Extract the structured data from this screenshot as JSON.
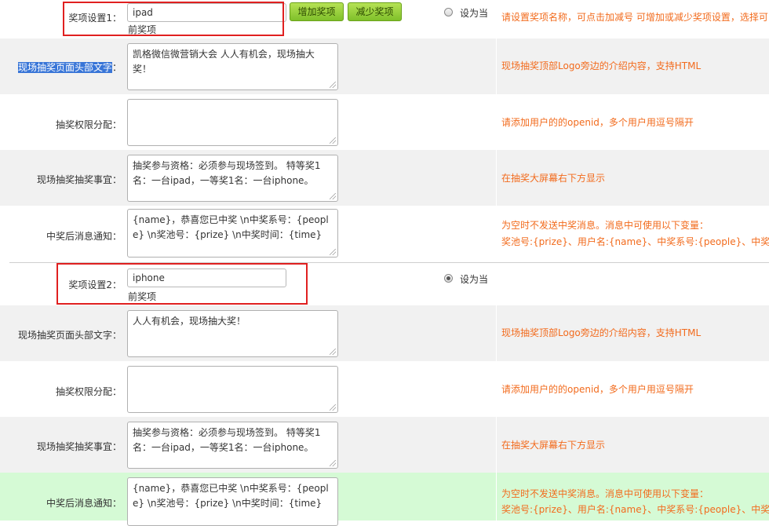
{
  "prizes": [
    {
      "setting_label": "奖项设置1：",
      "name_value": "ipad",
      "sub_label": "前奖项",
      "add_button": "增加奖项",
      "remove_button": "减少奖项",
      "radio_label": "设为当",
      "radio_checked": false,
      "setting_hint": "请设置奖项名称，可点击加减号 可增加或减少奖项设置，选择可",
      "header_text_label": "现场抽奖页面头部文字：",
      "header_text_label_highlighted": "现场抽奖页面头部文字",
      "header_text_label_suffix": "：",
      "header_text_value": "凯格微信微营销大会 人人有机会，现场抽大奖！",
      "header_text_hint": "现场抽奖顶部Logo旁边的介绍内容，支持HTML",
      "permission_label": "抽奖权限分配：",
      "permission_value": "",
      "permission_hint": "请添加用户的的openid，多个用户用逗号隔开",
      "matters_label": "现场抽奖抽奖事宜：",
      "matters_value": "抽奖参与资格：必须参与现场签到。 特等奖1名：一台ipad，一等奖1名：一台iphone。",
      "matters_hint": "在抽奖大屏幕右下方显示",
      "notify_label": "中奖后消息通知：",
      "notify_value": "{name}，恭喜您已中奖 \\n中奖系号：{people} \\n奖池号：{prize} \\n中奖时间：{time}",
      "notify_hint_line1": "为空时不发送中奖消息。消息中可使用以下变量：",
      "notify_hint_line2": "奖池号:{prize}、用户名:{name}、中奖系号:{people}、中奖时间"
    },
    {
      "setting_label": "奖项设置2：",
      "name_value": "iphone",
      "sub_label": "前奖项",
      "radio_label": "设为当",
      "radio_checked": true,
      "header_text_label": "现场抽奖页面头部文字：",
      "header_text_value": "人人有机会，现场抽大奖！",
      "header_text_hint": "现场抽奖顶部Logo旁边的介绍内容，支持HTML",
      "permission_label": "抽奖权限分配：",
      "permission_value": "",
      "permission_hint": "请添加用户的的openid，多个用户用逗号隔开",
      "matters_label": "现场抽奖抽奖事宜：",
      "matters_value": "抽奖参与资格：必须参与现场签到。 特等奖1名：一台ipad，一等奖1名：一台iphone。",
      "matters_hint": "在抽奖大屏幕右下方显示",
      "notify_label": "中奖后消息通知：",
      "notify_value": "{name}，恭喜您已中奖 \\n中奖系号：{people} \\n奖池号：{prize} \\n中奖时间：{time}",
      "notify_hint_line1": "为空时不发送中奖消息。消息中可使用以下变量：",
      "notify_hint_line2": "奖池号:{prize}、用户名:{name}、中奖系号:{people}、中奖时间"
    }
  ],
  "colors": {
    "hint": "#f26b1d",
    "shade_row": "#f1f1f1",
    "active_row": "#d5fad5",
    "button_green": "#7fc02a",
    "callout_red": "#e02020"
  }
}
